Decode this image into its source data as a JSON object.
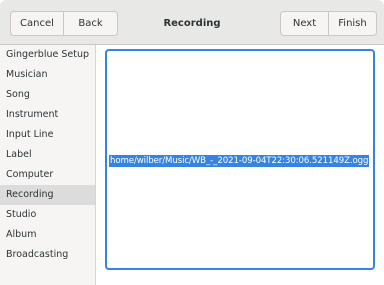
{
  "header": {
    "title": "Recording",
    "cancel_label": "Cancel",
    "back_label": "Back",
    "next_label": "Next",
    "finish_label": "Finish"
  },
  "sidebar": {
    "items": [
      {
        "label": "Gingerblue Setup"
      },
      {
        "label": "Musician"
      },
      {
        "label": "Song"
      },
      {
        "label": "Instrument"
      },
      {
        "label": "Input Line"
      },
      {
        "label": "Label"
      },
      {
        "label": "Computer"
      },
      {
        "label": "Recording"
      },
      {
        "label": "Studio"
      },
      {
        "label": "Album"
      },
      {
        "label": "Broadcasting"
      }
    ],
    "active_index": 7
  },
  "main": {
    "recording_path": "home/wilber/Music/WB_-_2021-09-04T22:30:06.521149Z.ogg"
  },
  "colors": {
    "accent": "#3584e4",
    "headerbar": "#e8e8e7",
    "sidebar_bg": "#f6f5f4",
    "sidebar_active": "#dcdcdc"
  }
}
